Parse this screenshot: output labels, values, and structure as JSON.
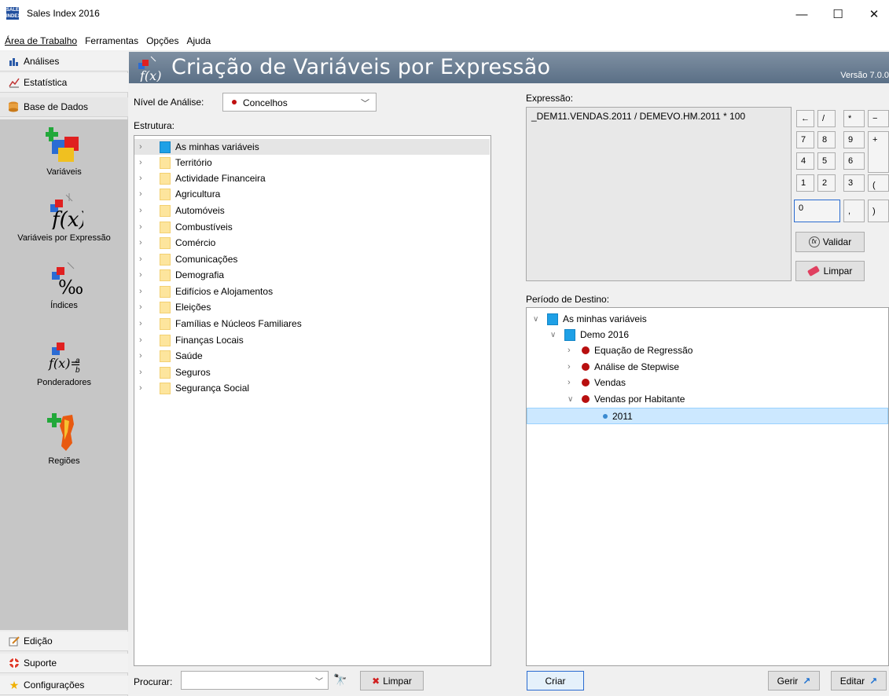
{
  "window": {
    "title": "Sales Index 2016",
    "minimize": "—",
    "maximize": "☐",
    "close": "✕"
  },
  "menu": [
    "Área de Trabalho",
    "Ferramentas",
    "Opções",
    "Ajuda"
  ],
  "nav": {
    "tabs_top": [
      "Análises",
      "Estatística",
      "Base de Dados"
    ],
    "items": [
      "Variáveis",
      "Variáveis por Expressão",
      "Índices",
      "Ponderadores",
      "Regiões"
    ],
    "tabs_bottom": [
      "Edição",
      "Suporte",
      "Configurações"
    ]
  },
  "banner": {
    "title": "Criação de Variáveis por Expressão",
    "version": "Versão 7.0.0"
  },
  "left": {
    "nivel_label": "Nível de Análise:",
    "nivel_value": "Concelhos",
    "estrutura_label": "Estrutura:",
    "tree": [
      "As minhas variáveis",
      "Território",
      "Actividade Financeira",
      "Agricultura",
      "Automóveis",
      "Combustíveis",
      "Comércio",
      "Comunicações",
      "Demografia",
      "Edifícios e Alojamentos",
      "Eleições",
      "Famílias e Núcleos Familiares",
      "Finanças Locais",
      "Saúde",
      "Seguros",
      "Segurança Social"
    ],
    "procurar_label": "Procurar:",
    "procurar_value": "",
    "limpar": "Limpar"
  },
  "expr": {
    "label": "Expressão:",
    "value": "_DEM11.VENDAS.2011 / DEMEVO.HM.2011 * 100",
    "keys": {
      "back": "←",
      "div": "/",
      "mul": "*",
      "minus": "−",
      "k7": "7",
      "k8": "8",
      "k9": "9",
      "plus": "+",
      "k4": "4",
      "k5": "5",
      "k6": "6",
      "k1": "1",
      "k2": "2",
      "k3": "3",
      "lp": "(",
      "k0": "0",
      "comma": ",",
      "rp": ")"
    },
    "validar": "Validar",
    "limpar": "Limpar"
  },
  "destino": {
    "label": "Período de Destino:",
    "root": "As minhas variáveis",
    "demo": "Demo 2016",
    "items": [
      "Equação de Regressão",
      "Análise de Stepwise",
      "Vendas",
      "Vendas por Habitante"
    ],
    "year": "2011"
  },
  "footer": {
    "criar": "Criar",
    "gerir": "Gerir",
    "editar": "Editar"
  }
}
